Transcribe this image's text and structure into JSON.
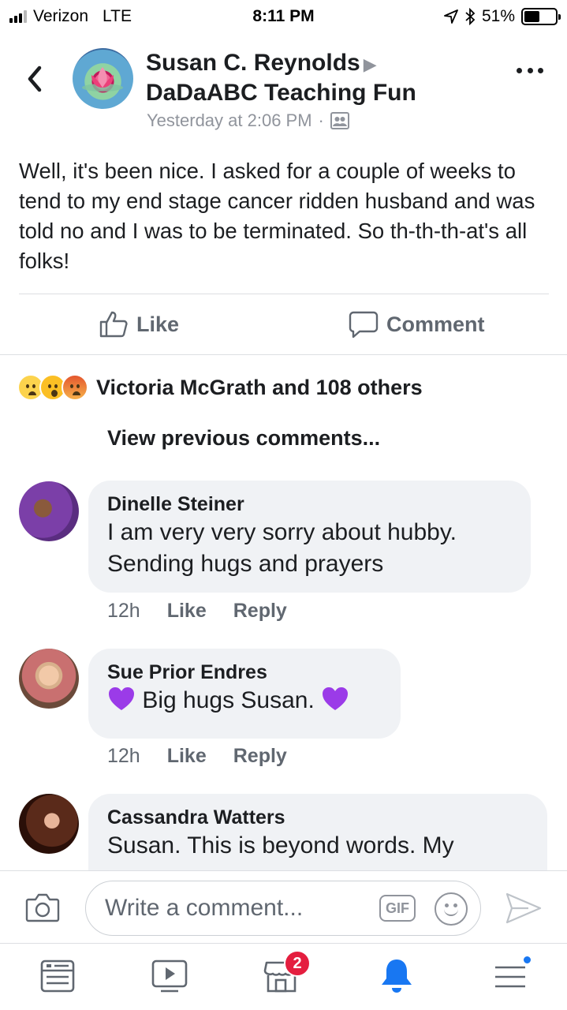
{
  "status_bar": {
    "carrier": "Verizon",
    "network": "LTE",
    "time": "8:11 PM",
    "battery": "51%",
    "battery_level": 0.51,
    "signal_bars": 4,
    "signal_bars_filled": 3
  },
  "post": {
    "author": "Susan C. Reynolds",
    "group": "DaDaABC Teaching Fun",
    "arrow_glyph": "▶",
    "timestamp": "Yesterday at 2:06 PM",
    "separator": "·",
    "audience_icon": "group-audience-icon",
    "body": "Well, it's been nice. I asked for a couple of weeks to tend to my end stage cancer ridden husband and was told no and I was to be terminated. So th-th-th-at's all folks!"
  },
  "actions": {
    "like_label": "Like",
    "comment_label": "Comment"
  },
  "reactions": {
    "icons": [
      "sad-reaction-icon",
      "wow-reaction-icon",
      "angry-reaction-icon"
    ],
    "summary": "Victoria McGrath and 108 others"
  },
  "view_previous": "View previous comments...",
  "comments": [
    {
      "name": "Dinelle Steiner",
      "text_line1": "I am very very sorry about hubby.",
      "text_line2": "Sending hugs and prayers",
      "time": "12h",
      "like_label": "Like",
      "reply_label": "Reply"
    },
    {
      "name": "Sue Prior Endres",
      "text": "Big hugs Susan.",
      "emoji": "purple-heart",
      "time": "12h",
      "like_label": "Like",
      "reply_label": "Reply"
    },
    {
      "name": "Cassandra Watters",
      "text": "Susan. This is beyond words. My"
    }
  ],
  "composer": {
    "placeholder": "Write a comment...",
    "gif_label": "GIF"
  },
  "tab_bar": {
    "marketplace_badge": "2"
  },
  "colors": {
    "accent_blue": "#1877f2",
    "badge_red": "#e41e3f",
    "heart_purple": "#9b3be8",
    "bubble_gray": "#f0f2f5"
  }
}
